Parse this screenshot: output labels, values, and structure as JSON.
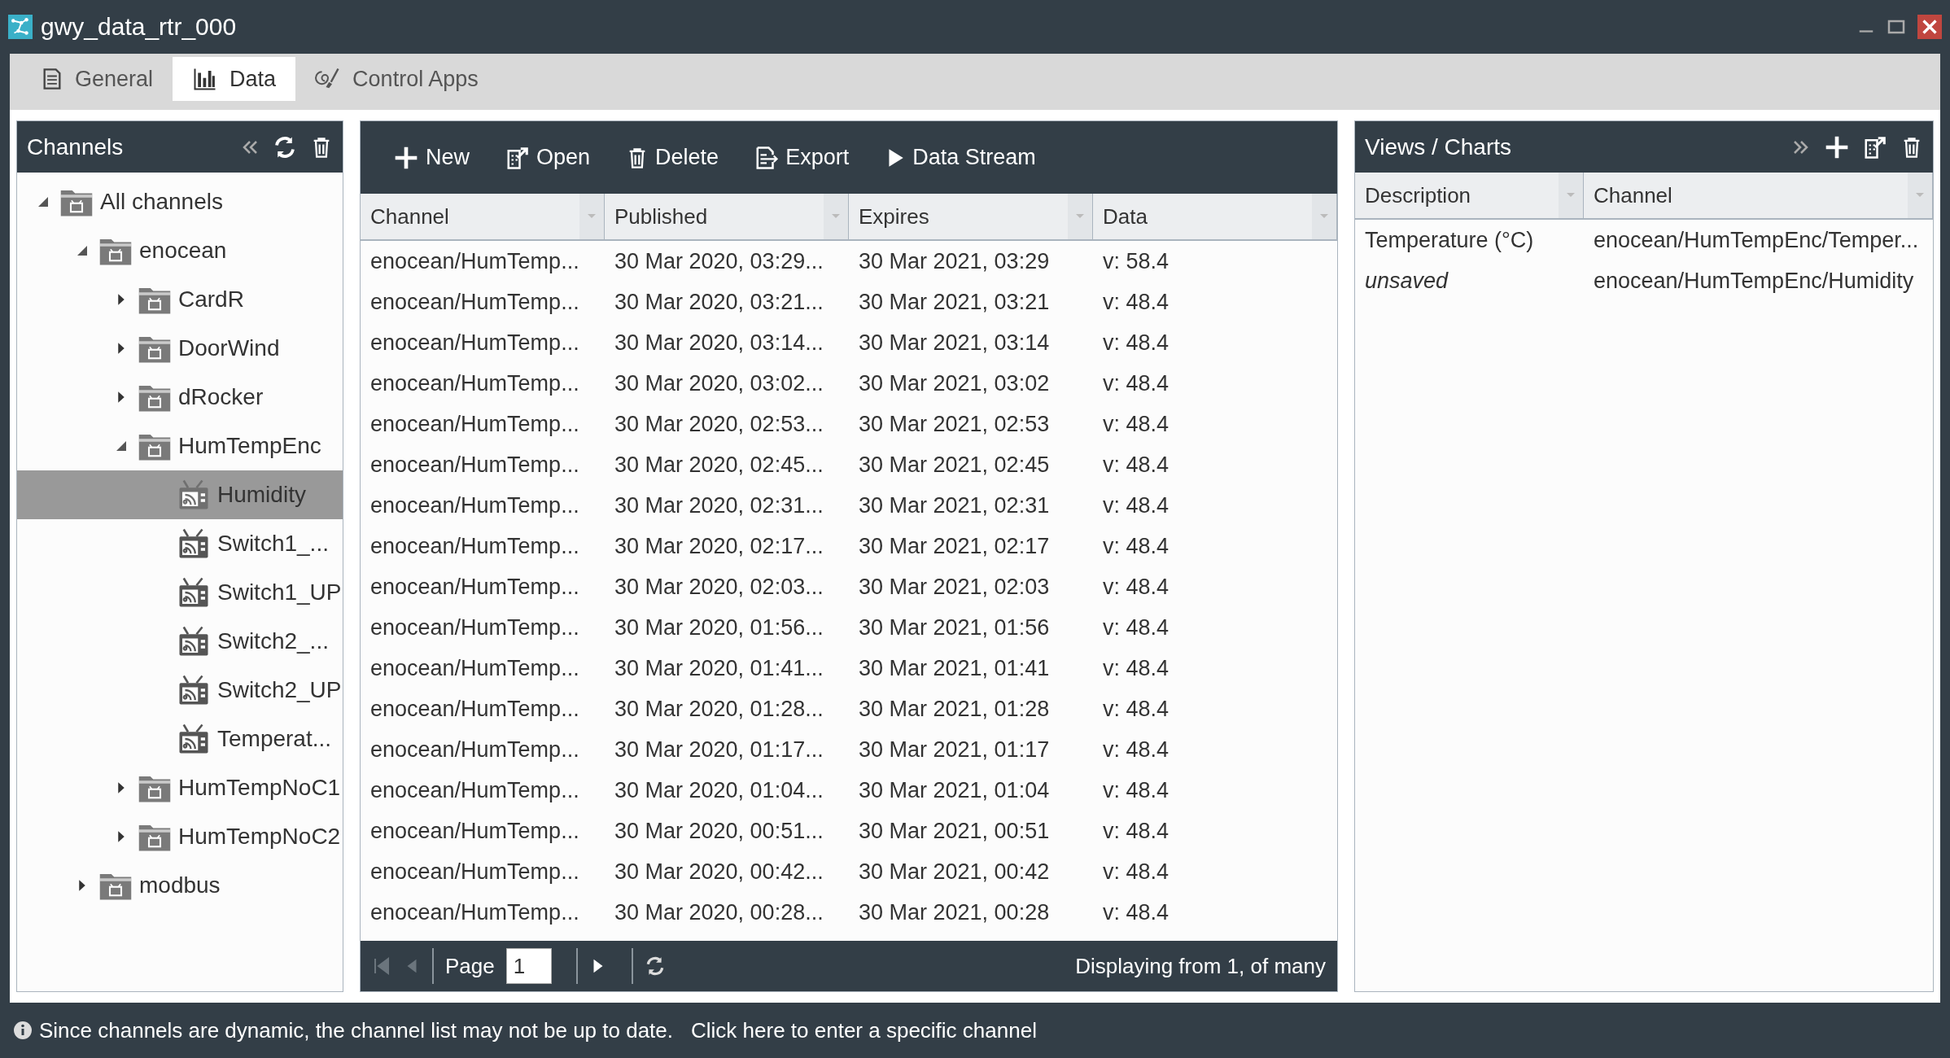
{
  "window": {
    "title": "gwy_data_rtr_000"
  },
  "tabs": [
    {
      "label": "General",
      "selected": false
    },
    {
      "label": "Data",
      "selected": true
    },
    {
      "label": "Control Apps",
      "selected": false
    }
  ],
  "channels_panel": {
    "title": "Channels",
    "tree": [
      {
        "label": "All channels",
        "kind": "folder",
        "expanded": true,
        "selected": false,
        "children": [
          {
            "label": "enocean",
            "kind": "folder",
            "expanded": true,
            "selected": false,
            "children": [
              {
                "label": "CardR",
                "kind": "folder",
                "expanded": false,
                "selected": false
              },
              {
                "label": "DoorWind",
                "kind": "folder",
                "expanded": false,
                "selected": false
              },
              {
                "label": "dRocker",
                "kind": "folder",
                "expanded": false,
                "selected": false
              },
              {
                "label": "HumTempEnc",
                "kind": "folder",
                "expanded": true,
                "selected": false,
                "children": [
                  {
                    "label": "Humidity",
                    "kind": "channel",
                    "selected": true
                  },
                  {
                    "label": "Switch1_...",
                    "kind": "channel",
                    "selected": false
                  },
                  {
                    "label": "Switch1_UP",
                    "kind": "channel",
                    "selected": false
                  },
                  {
                    "label": "Switch2_...",
                    "kind": "channel",
                    "selected": false
                  },
                  {
                    "label": "Switch2_UP",
                    "kind": "channel",
                    "selected": false
                  },
                  {
                    "label": "Temperat...",
                    "kind": "channel",
                    "selected": false
                  }
                ]
              },
              {
                "label": "HumTempNoC1",
                "kind": "folder",
                "expanded": false,
                "selected": false
              },
              {
                "label": "HumTempNoC2",
                "kind": "folder",
                "expanded": false,
                "selected": false
              }
            ]
          },
          {
            "label": "modbus",
            "kind": "folder",
            "expanded": false,
            "selected": false
          }
        ]
      }
    ]
  },
  "data_panel": {
    "toolbar": [
      "New",
      "Open",
      "Delete",
      "Export",
      "Data Stream"
    ],
    "columns": [
      "Channel",
      "Published",
      "Expires",
      "Data"
    ],
    "rows": [
      [
        "enocean/HumTemp...",
        "30 Mar 2020, 03:29...",
        "30 Mar 2021, 03:29",
        "v: 58.4"
      ],
      [
        "enocean/HumTemp...",
        "30 Mar 2020, 03:21...",
        "30 Mar 2021, 03:21",
        "v: 48.4"
      ],
      [
        "enocean/HumTemp...",
        "30 Mar 2020, 03:14...",
        "30 Mar 2021, 03:14",
        "v: 48.4"
      ],
      [
        "enocean/HumTemp...",
        "30 Mar 2020, 03:02...",
        "30 Mar 2021, 03:02",
        "v: 48.4"
      ],
      [
        "enocean/HumTemp...",
        "30 Mar 2020, 02:53...",
        "30 Mar 2021, 02:53",
        "v: 48.4"
      ],
      [
        "enocean/HumTemp...",
        "30 Mar 2020, 02:45...",
        "30 Mar 2021, 02:45",
        "v: 48.4"
      ],
      [
        "enocean/HumTemp...",
        "30 Mar 2020, 02:31...",
        "30 Mar 2021, 02:31",
        "v: 48.4"
      ],
      [
        "enocean/HumTemp...",
        "30 Mar 2020, 02:17...",
        "30 Mar 2021, 02:17",
        "v: 48.4"
      ],
      [
        "enocean/HumTemp...",
        "30 Mar 2020, 02:03...",
        "30 Mar 2021, 02:03",
        "v: 48.4"
      ],
      [
        "enocean/HumTemp...",
        "30 Mar 2020, 01:56...",
        "30 Mar 2021, 01:56",
        "v: 48.4"
      ],
      [
        "enocean/HumTemp...",
        "30 Mar 2020, 01:41...",
        "30 Mar 2021, 01:41",
        "v: 48.4"
      ],
      [
        "enocean/HumTemp...",
        "30 Mar 2020, 01:28...",
        "30 Mar 2021, 01:28",
        "v: 48.4"
      ],
      [
        "enocean/HumTemp...",
        "30 Mar 2020, 01:17...",
        "30 Mar 2021, 01:17",
        "v: 48.4"
      ],
      [
        "enocean/HumTemp...",
        "30 Mar 2020, 01:04...",
        "30 Mar 2021, 01:04",
        "v: 48.4"
      ],
      [
        "enocean/HumTemp...",
        "30 Mar 2020, 00:51...",
        "30 Mar 2021, 00:51",
        "v: 48.4"
      ],
      [
        "enocean/HumTemp...",
        "30 Mar 2020, 00:42...",
        "30 Mar 2021, 00:42",
        "v: 48.4"
      ],
      [
        "enocean/HumTemp...",
        "30 Mar 2020, 00:28...",
        "30 Mar 2021, 00:28",
        "v: 48.4"
      ]
    ],
    "pager": {
      "page_label": "Page",
      "page": "1",
      "status": "Displaying from 1, of many"
    }
  },
  "views_panel": {
    "title": "Views / Charts",
    "columns": [
      "Description",
      "Channel"
    ],
    "rows": [
      {
        "description": "Temperature (°C)",
        "channel": "enocean/HumTempEnc/Temper...",
        "saved": true
      },
      {
        "description": "unsaved",
        "channel": "enocean/HumTempEnc/Humidity",
        "saved": false
      }
    ]
  },
  "footer": {
    "message": "Since channels are dynamic, the channel list may not be up to date.",
    "link": "Click here to enter a specific channel"
  }
}
